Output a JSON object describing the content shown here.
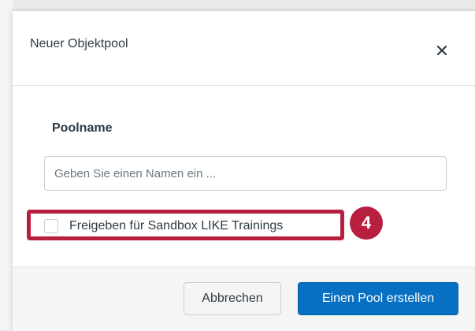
{
  "dialog": {
    "title": "Neuer Objektpool",
    "close_icon": "close-icon"
  },
  "form": {
    "pool_name_label": "Poolname",
    "pool_name_value": "",
    "pool_name_placeholder": "Geben Sie einen Namen ein ...",
    "share_checkbox_label": "Freigeben für Sandbox LIKE Trainings",
    "share_checkbox_checked": false
  },
  "annotation": {
    "step_number": "4",
    "color": "#b81f3f"
  },
  "footer": {
    "cancel_label": "Abbrechen",
    "create_label": "Einen Pool erstellen"
  },
  "colors": {
    "primary_button": "#0770c2",
    "text": "#2d3b45"
  }
}
